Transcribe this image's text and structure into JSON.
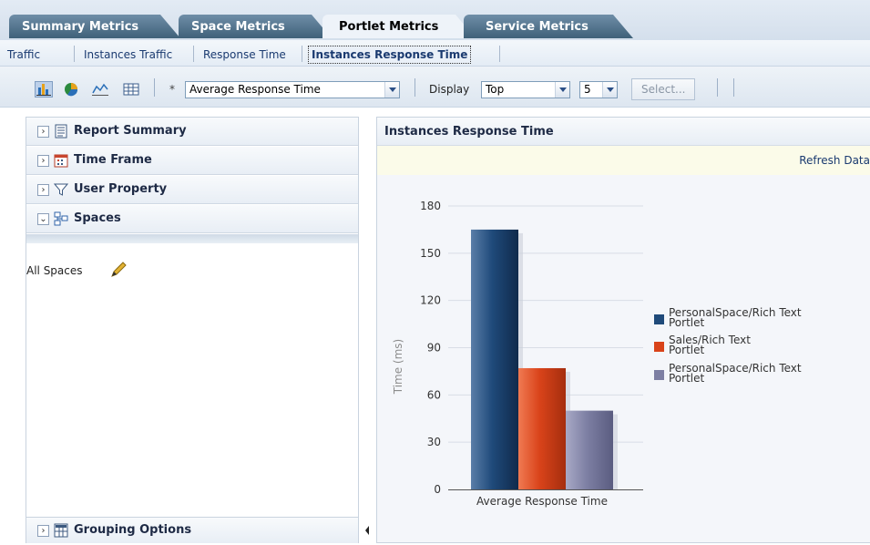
{
  "tabs": [
    {
      "label": "Summary Metrics",
      "active": false
    },
    {
      "label": "Space Metrics",
      "active": false
    },
    {
      "label": "Portlet Metrics",
      "active": true
    },
    {
      "label": "Service Metrics",
      "active": false
    }
  ],
  "subtabs": [
    {
      "label": "Traffic",
      "selected": false
    },
    {
      "label": "Instances Traffic",
      "selected": false
    },
    {
      "label": "Response Time",
      "selected": false
    },
    {
      "label": "Instances Response Time",
      "selected": true
    }
  ],
  "toolbar": {
    "view_icons": [
      "bar-chart-icon",
      "pie-chart-icon",
      "line-chart-icon",
      "table-icon"
    ],
    "required_marker": "*",
    "metric_select": "Average Response Time",
    "display_label": "Display",
    "display_select": "Top",
    "count_select": "5",
    "select_button": "Select..."
  },
  "left_panel": {
    "sections": [
      {
        "label": "Report Summary",
        "toggle": "›",
        "icon": "report-icon"
      },
      {
        "label": "Time Frame",
        "toggle": "›",
        "icon": "calendar-icon"
      },
      {
        "label": "User Property",
        "toggle": "›",
        "icon": "filter-icon"
      },
      {
        "label": "Spaces",
        "toggle": "⌄",
        "icon": "spaces-icon"
      }
    ],
    "spaces_value": "All Spaces",
    "grouping": {
      "label": "Grouping Options",
      "icon": "grouping-icon"
    }
  },
  "right_panel": {
    "title": "Instances Response Time",
    "refresh_link": "Refresh Data"
  },
  "chart_data": {
    "type": "bar",
    "categories": [
      "Average Response Time"
    ],
    "series": [
      {
        "name": "PersonalSpace/Rich Text Portlet",
        "values": [
          165
        ],
        "color": "#1f4a7a"
      },
      {
        "name": "Sales/Rich Text Portlet",
        "values": [
          77
        ],
        "color": "#d9431a"
      },
      {
        "name": "PersonalSpace/Rich Text Portlet",
        "values": [
          50
        ],
        "color": "#7d7fa3"
      }
    ],
    "ylabel": "Time (ms)",
    "xlabel": "",
    "ylim": [
      0,
      180
    ],
    "yticks": [
      0,
      30,
      60,
      90,
      120,
      150,
      180
    ],
    "grid": true,
    "legend": "right"
  }
}
